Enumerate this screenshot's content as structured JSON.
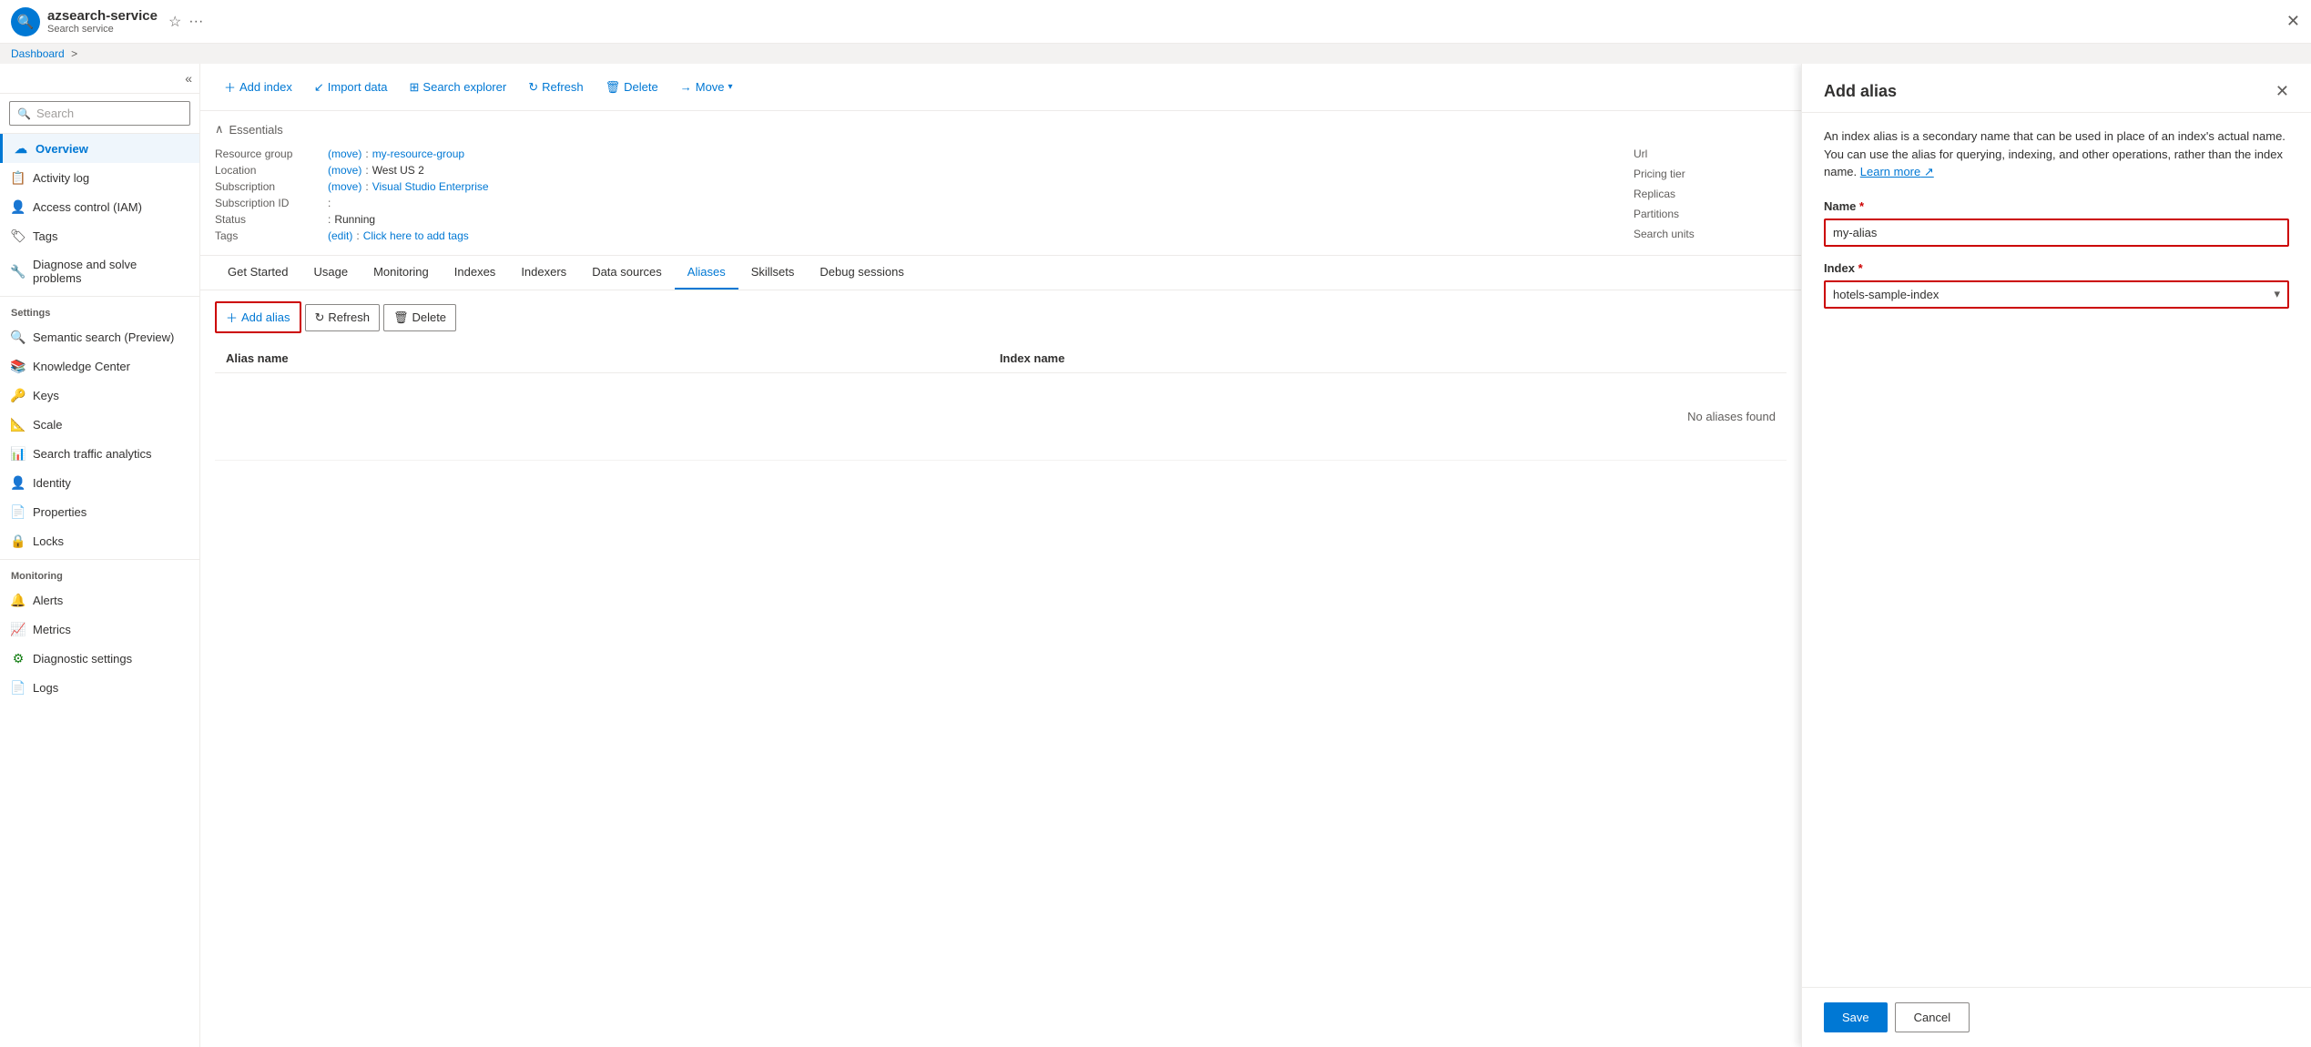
{
  "topbar": {
    "logo_icon": "🔍",
    "service_name": "azsearch-service",
    "service_type": "Search service",
    "star_icon": "☆",
    "more_icon": "···",
    "close_icon": "✕"
  },
  "breadcrumb": {
    "items": [
      "Dashboard",
      ">"
    ]
  },
  "sidebar": {
    "search_placeholder": "Search",
    "collapse_icon": "«",
    "nav_items": [
      {
        "id": "overview",
        "label": "Overview",
        "icon": "☁",
        "icon_color": "icon-blue",
        "active": true
      },
      {
        "id": "activity-log",
        "label": "Activity log",
        "icon": "📋",
        "icon_color": ""
      },
      {
        "id": "access-control",
        "label": "Access control (IAM)",
        "icon": "👤",
        "icon_color": ""
      },
      {
        "id": "tags",
        "label": "Tags",
        "icon": "🏷",
        "icon_color": ""
      },
      {
        "id": "diagnose",
        "label": "Diagnose and solve problems",
        "icon": "🔧",
        "icon_color": ""
      }
    ],
    "settings_section": "Settings",
    "settings_items": [
      {
        "id": "semantic-search",
        "label": "Semantic search (Preview)",
        "icon": "🔍",
        "icon_color": "icon-blue"
      },
      {
        "id": "knowledge-center",
        "label": "Knowledge Center",
        "icon": "📚",
        "icon_color": "icon-blue"
      },
      {
        "id": "keys",
        "label": "Keys",
        "icon": "🔑",
        "icon_color": "icon-yellow"
      },
      {
        "id": "scale",
        "label": "Scale",
        "icon": "📐",
        "icon_color": ""
      },
      {
        "id": "search-traffic",
        "label": "Search traffic analytics",
        "icon": "📊",
        "icon_color": "icon-blue"
      },
      {
        "id": "identity",
        "label": "Identity",
        "icon": "👤",
        "icon_color": ""
      },
      {
        "id": "properties",
        "label": "Properties",
        "icon": "📄",
        "icon_color": ""
      },
      {
        "id": "locks",
        "label": "Locks",
        "icon": "🔒",
        "icon_color": ""
      }
    ],
    "monitoring_section": "Monitoring",
    "monitoring_items": [
      {
        "id": "alerts",
        "label": "Alerts",
        "icon": "🔔",
        "icon_color": "icon-green"
      },
      {
        "id": "metrics",
        "label": "Metrics",
        "icon": "📈",
        "icon_color": "icon-blue"
      },
      {
        "id": "diagnostic-settings",
        "label": "Diagnostic settings",
        "icon": "⚙",
        "icon_color": "icon-green"
      },
      {
        "id": "logs",
        "label": "Logs",
        "icon": "📄",
        "icon_color": "icon-blue"
      }
    ]
  },
  "toolbar": {
    "add_index_label": "Add index",
    "import_data_label": "Import data",
    "search_explorer_label": "Search explorer",
    "refresh_label": "Refresh",
    "delete_label": "Delete",
    "move_label": "Move"
  },
  "essentials": {
    "header": "Essentials",
    "collapse_icon": "∧",
    "fields": [
      {
        "label": "Resource group",
        "value": "my-resource-group",
        "link": true,
        "link_text": "(move)",
        "colon": true
      },
      {
        "label": "Location",
        "value": "West US 2",
        "link": true,
        "link_text": "(move)",
        "colon": true
      },
      {
        "label": "Subscription",
        "value": "Visual Studio Enterprise",
        "link": true,
        "link_text": "(move)",
        "colon": true
      },
      {
        "label": "Subscription ID",
        "value": "",
        "colon": true
      },
      {
        "label": "Status",
        "value": "Running",
        "colon": true
      },
      {
        "label": "Tags",
        "value": "Click here to add tags",
        "link": true,
        "link_text": "(edit)",
        "colon": true
      }
    ],
    "right_fields": [
      {
        "label": "Url",
        "value": ""
      },
      {
        "label": "Pricing tier",
        "value": ""
      },
      {
        "label": "Replicas",
        "value": ""
      },
      {
        "label": "Partitions",
        "value": ""
      },
      {
        "label": "Search units",
        "value": ""
      }
    ]
  },
  "tabs": {
    "items": [
      {
        "id": "get-started",
        "label": "Get Started"
      },
      {
        "id": "usage",
        "label": "Usage"
      },
      {
        "id": "monitoring",
        "label": "Monitoring"
      },
      {
        "id": "indexes",
        "label": "Indexes"
      },
      {
        "id": "indexers",
        "label": "Indexers"
      },
      {
        "id": "data-sources",
        "label": "Data sources"
      },
      {
        "id": "aliases",
        "label": "Aliases",
        "active": true
      },
      {
        "id": "skillsets",
        "label": "Skillsets"
      },
      {
        "id": "debug-sessions",
        "label": "Debug sessions"
      }
    ]
  },
  "aliases_toolbar": {
    "add_alias_label": "Add alias",
    "refresh_label": "Refresh",
    "delete_label": "Delete"
  },
  "aliases_table": {
    "columns": [
      "Alias name",
      "Index name"
    ],
    "no_data_message": "No aliases found"
  },
  "add_alias_panel": {
    "title": "Add alias",
    "close_icon": "✕",
    "description": "An index alias is a secondary name that can be used in place of an index's actual name. You can use the alias for querying, indexing, and other operations, rather than the index name.",
    "learn_more": "Learn more",
    "name_label": "Name",
    "name_required": "*",
    "name_value": "my-alias",
    "name_placeholder": "",
    "index_label": "Index",
    "index_required": "*",
    "index_value": "hotels-sample-index",
    "index_options": [
      "hotels-sample-index"
    ],
    "save_label": "Save",
    "cancel_label": "Cancel"
  }
}
